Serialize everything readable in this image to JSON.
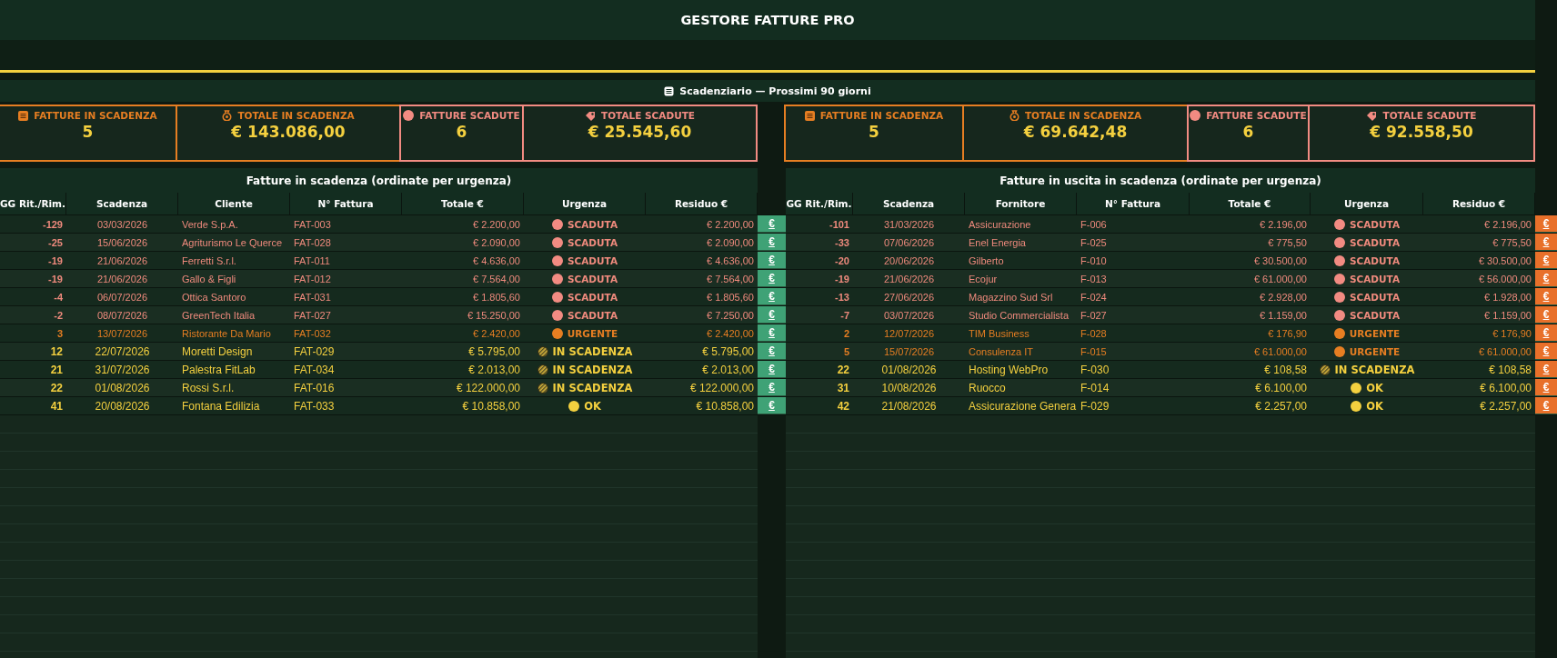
{
  "title": "GESTORE FATTURE PRO",
  "section_header": "Scadenziario — Prossimi 90 giorni",
  "panels": [
    {
      "kind": "receivable",
      "kpis": [
        {
          "kind": "count",
          "label": "FATTURE IN SCADENZA",
          "value": "5"
        },
        {
          "kind": "amount",
          "label": "TOTALE IN SCADENZA",
          "value": "€ 143.086,00"
        },
        {
          "kind": "overdue_count",
          "label": "FATTURE SCADUTE",
          "value": "6"
        },
        {
          "kind": "overdue_amount",
          "label": "TOTALE SCADUTE",
          "value": "€ 25.545,60"
        }
      ],
      "table": {
        "title": "Fatture in scadenza (ordinate per urgenza)",
        "columns": [
          "GG Rit./Rim.",
          "Scadenza",
          "Cliente",
          "N° Fattura",
          "Totale €",
          "Urgenza",
          "Residuo €"
        ],
        "rows": [
          {
            "kind": "scaduta",
            "days": "-129",
            "due": "03/03/2026",
            "party": "Verde S.p.A.",
            "number": "FAT-003",
            "total": "€ 2.200,00",
            "urgency": "SCADUTA",
            "residual": "€ 2.200,00",
            "action": "€"
          },
          {
            "kind": "scaduta",
            "days": "-25",
            "due": "15/06/2026",
            "party": "Agriturismo Le Querce",
            "number": "FAT-028",
            "total": "€ 2.090,00",
            "urgency": "SCADUTA",
            "residual": "€ 2.090,00",
            "action": "€"
          },
          {
            "kind": "scaduta",
            "days": "-19",
            "due": "21/06/2026",
            "party": "Ferretti S.r.l.",
            "number": "FAT-011",
            "total": "€ 4.636,00",
            "urgency": "SCADUTA",
            "residual": "€ 4.636,00",
            "action": "€"
          },
          {
            "kind": "scaduta",
            "days": "-19",
            "due": "21/06/2026",
            "party": "Gallo & Figli",
            "number": "FAT-012",
            "total": "€ 7.564,00",
            "urgency": "SCADUTA",
            "residual": "€ 7.564,00",
            "action": "€"
          },
          {
            "kind": "scaduta",
            "days": "-4",
            "due": "06/07/2026",
            "party": "Ottica Santoro",
            "number": "FAT-031",
            "total": "€ 1.805,60",
            "urgency": "SCADUTA",
            "residual": "€ 1.805,60",
            "action": "€"
          },
          {
            "kind": "scaduta",
            "days": "-2",
            "due": "08/07/2026",
            "party": "GreenTech Italia",
            "number": "FAT-027",
            "total": "€ 15.250,00",
            "urgency": "SCADUTA",
            "residual": "€ 7.250,00",
            "action": "€"
          },
          {
            "kind": "urgente",
            "days": "3",
            "due": "13/07/2026",
            "party": "Ristorante Da Mario",
            "number": "FAT-032",
            "total": "€ 2.420,00",
            "urgency": "URGENTE",
            "residual": "€ 2.420,00",
            "action": "€"
          },
          {
            "kind": "in_scadenza",
            "days": "12",
            "due": "22/07/2026",
            "party": "Moretti Design",
            "number": "FAT-029",
            "total": "€ 5.795,00",
            "urgency": "IN SCADENZA",
            "residual": "€ 5.795,00",
            "action": "€"
          },
          {
            "kind": "in_scadenza",
            "days": "21",
            "due": "31/07/2026",
            "party": "Palestra FitLab",
            "number": "FAT-034",
            "total": "€ 2.013,00",
            "urgency": "IN SCADENZA",
            "residual": "€ 2.013,00",
            "action": "€"
          },
          {
            "kind": "in_scadenza",
            "days": "22",
            "due": "01/08/2026",
            "party": "Rossi S.r.l.",
            "number": "FAT-016",
            "total": "€ 122.000,00",
            "urgency": "IN SCADENZA",
            "residual": "€ 122.000,00",
            "action": "€"
          },
          {
            "kind": "ok",
            "days": "41",
            "due": "20/08/2026",
            "party": "Fontana Edilizia",
            "number": "FAT-033",
            "total": "€ 10.858,00",
            "urgency": "OK",
            "residual": "€ 10.858,00",
            "action": "€"
          }
        ]
      }
    },
    {
      "kind": "payable",
      "kpis": [
        {
          "kind": "count",
          "label": "FATTURE IN SCADENZA",
          "value": "5"
        },
        {
          "kind": "amount",
          "label": "TOTALE IN SCADENZA",
          "value": "€ 69.642,48"
        },
        {
          "kind": "overdue_count",
          "label": "FATTURE SCADUTE",
          "value": "6"
        },
        {
          "kind": "overdue_amount",
          "label": "TOTALE SCADUTE",
          "value": "€ 92.558,50"
        }
      ],
      "table": {
        "title": "Fatture in uscita in scadenza (ordinate per urgenza)",
        "columns": [
          "GG Rit./Rim.",
          "Scadenza",
          "Fornitore",
          "N° Fattura",
          "Totale €",
          "Urgenza",
          "Residuo €"
        ],
        "rows": [
          {
            "kind": "scaduta",
            "days": "-101",
            "due": "31/03/2026",
            "party": "Assicurazione",
            "number": "F-006",
            "total": "€ 2.196,00",
            "urgency": "SCADUTA",
            "residual": "€ 2.196,00",
            "action": "€"
          },
          {
            "kind": "scaduta",
            "days": "-33",
            "due": "07/06/2026",
            "party": "Enel Energia",
            "number": "F-025",
            "total": "€ 775,50",
            "urgency": "SCADUTA",
            "residual": "€ 775,50",
            "action": "€"
          },
          {
            "kind": "scaduta",
            "days": "-20",
            "due": "20/06/2026",
            "party": "Gilberto",
            "number": "F-010",
            "total": "€ 30.500,00",
            "urgency": "SCADUTA",
            "residual": "€ 30.500,00",
            "action": "€"
          },
          {
            "kind": "scaduta",
            "days": "-19",
            "due": "21/06/2026",
            "party": "Ecojur",
            "number": "F-013",
            "total": "€ 61.000,00",
            "urgency": "SCADUTA",
            "residual": "€ 56.000,00",
            "action": "€"
          },
          {
            "kind": "scaduta",
            "days": "-13",
            "due": "27/06/2026",
            "party": "Magazzino Sud Srl",
            "number": "F-024",
            "total": "€ 2.928,00",
            "urgency": "SCADUTA",
            "residual": "€ 1.928,00",
            "action": "€"
          },
          {
            "kind": "scaduta",
            "days": "-7",
            "due": "03/07/2026",
            "party": "Studio Commercialista",
            "number": "F-027",
            "total": "€ 1.159,00",
            "urgency": "SCADUTA",
            "residual": "€ 1.159,00",
            "action": "€"
          },
          {
            "kind": "urgente",
            "days": "2",
            "due": "12/07/2026",
            "party": "TIM Business",
            "number": "F-028",
            "total": "€ 176,90",
            "urgency": "URGENTE",
            "residual": "€ 176,90",
            "action": "€"
          },
          {
            "kind": "urgente",
            "days": "5",
            "due": "15/07/2026",
            "party": "Consulenza IT",
            "number": "F-015",
            "total": "€ 61.000,00",
            "urgency": "URGENTE",
            "residual": "€ 61.000,00",
            "action": "€"
          },
          {
            "kind": "in_scadenza",
            "days": "22",
            "due": "01/08/2026",
            "party": "Hosting WebPro",
            "number": "F-030",
            "total": "€ 108,58",
            "urgency": "IN SCADENZA",
            "residual": "€ 108,58",
            "action": "€"
          },
          {
            "kind": "ok",
            "days": "31",
            "due": "10/08/2026",
            "party": "Ruocco",
            "number": "F-014",
            "total": "€ 6.100,00",
            "urgency": "OK",
            "residual": "€ 6.100,00",
            "action": "€"
          },
          {
            "kind": "ok",
            "days": "42",
            "due": "21/08/2026",
            "party": "Assicurazione Genera",
            "number": "F-029",
            "total": "€ 2.257,00",
            "urgency": "OK",
            "residual": "€ 2.257,00",
            "action": "€"
          }
        ]
      }
    }
  ]
}
